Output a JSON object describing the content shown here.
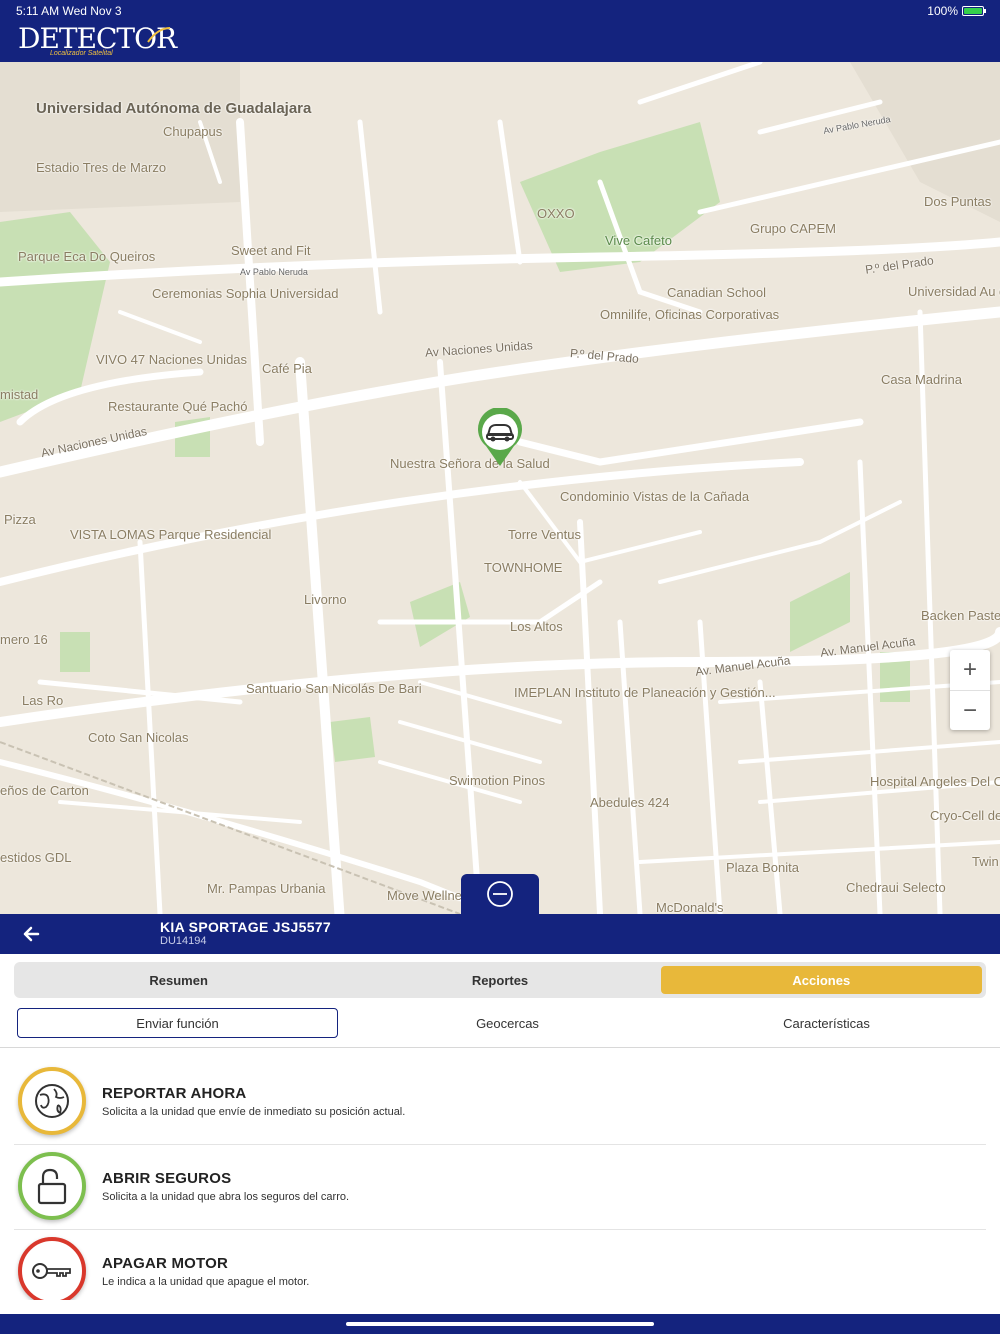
{
  "status": {
    "time": "5:11 AM  Wed Nov 3",
    "battery": "100%"
  },
  "app": {
    "logo": "DETECTOR",
    "logo_sub": "Localizador Satelital"
  },
  "map": {
    "labels": {
      "uni": "Universidad Autónoma de Guadalajara",
      "estadio": "Estadio Tres de Marzo",
      "chupapus": "Chupapus",
      "parque": "Parque Eca Do Queiros",
      "sweet": "Sweet and Fit",
      "ceremonias": "Ceremonias Sophia Universidad",
      "oxxo": "OXXO",
      "vive": "Vive Cafeto",
      "capem": "Grupo CAPEM",
      "dospuntas": "Dos Puntas",
      "canadian": "Canadian School",
      "omnilife": "Omnilife, Oficinas Corporativas",
      "univ2": "Universidad Au de Guada",
      "vivo": "VIVO 47 Naciones Unidas",
      "cafepia": "Café Pia",
      "restaurante": "Restaurante Qué Pachó",
      "casamadrina": "Casa Madrina",
      "nuestra": "Nuestra Señora de la Salud",
      "condominio": "Condominio Vistas de la Cañada",
      "torre": "Torre Ventus",
      "townhome": "TOWNHOME",
      "vistalomas": "VISTA LOMAS Parque Residencial",
      "pizza": "Pizza",
      "livorno": "Livorno",
      "losaltos": "Los Altos",
      "backen": "Backen Paste",
      "santuario": "Santuario San Nicolás De Bari",
      "imeplan": "IMEPLAN Instituto de Planeación y Gestión...",
      "cotosan": "Coto San Nicolas",
      "lasro": "Las Ro",
      "swimotion": "Swimotion Pinos",
      "abedules": "Abedules 424",
      "hospital": "Hospital Angeles Del Carmen",
      "cryo": "Cryo-Cell de",
      "plazabonita": "Plaza Bonita",
      "chedraui": "Chedraui Selecto",
      "mcdonalds": "McDonald's",
      "mrpampas": "Mr. Pampas Urbania",
      "move": "Move Wellne Family Urba",
      "carton": "eños de Carton",
      "estidos": "estidos GDL",
      "mistad": "mistad",
      "mero": "mero 16",
      "twin": "Twin",
      "av_naciones": "Av Naciones Unidas",
      "av_naciones2": "Av Naciones Unidas",
      "prado": "P.º del Prado",
      "prado2": "P.º del Prado",
      "manuel": "Av. Manuel Acuña",
      "manuel2": "Av. Manuel Acuña",
      "pablo": "Av Pablo Neruda",
      "pablo2": "Av Pablo Neruda"
    },
    "zoom_in": "+",
    "zoom_out": "−"
  },
  "vehicle": {
    "name": "KIA SPORTAGE JSJ5577",
    "id": "DU14194"
  },
  "tabs": [
    "Resumen",
    "Reportes",
    "Acciones"
  ],
  "subtabs": [
    "Enviar función",
    "Geocercas",
    "Características"
  ],
  "actions": [
    {
      "title": "REPORTAR AHORA",
      "desc": "Solicita a la unidad que envíe de inmediato su posición actual.",
      "color": "#e8b83a"
    },
    {
      "title": "ABRIR SEGUROS",
      "desc": "Solicita a la unidad que abra los seguros del carro.",
      "color": "#7dbf4f"
    },
    {
      "title": "APAGAR MOTOR",
      "desc": "Le indica a la unidad que apague el motor.",
      "color": "#d9382c"
    }
  ],
  "colors": {
    "navy": "#14237e",
    "accent": "#e8b83a",
    "map_bg": "#ede7dc",
    "park": "#c8e0b4",
    "marker": "#5aa84a"
  }
}
